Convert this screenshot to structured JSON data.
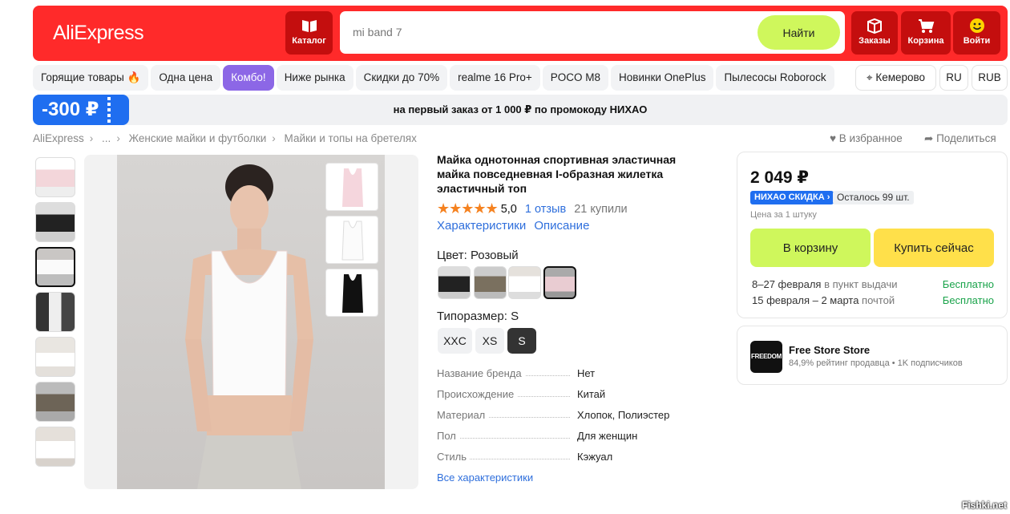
{
  "header": {
    "logo": "AliExpress",
    "catalog_label": "Каталог",
    "search_placeholder": "mi band 7",
    "search_button": "Найти",
    "orders_label": "Заказы",
    "cart_label": "Корзина",
    "login_label": "Войти",
    "brand_color": "#ff2a2a"
  },
  "chips": [
    "Горящие товары 🔥",
    "Одна цена",
    "Комбо!",
    "Ниже рынка",
    "Скидки до 70%",
    "realme 16 Pro+",
    "POCO M8",
    "Новинки OnePlus",
    "Пылесосы Roborock"
  ],
  "location": {
    "city": "Кемерово",
    "language": "RU",
    "currency": "RUB"
  },
  "promo": {
    "amount": "-300 ₽",
    "text": "на первый заказ от 1 000 ₽ по промокоду НИХАО"
  },
  "breadcrumbs": [
    "AliExpress",
    "...",
    "Женские майки и футболки",
    "Майки и топы на бретелях"
  ],
  "actions": {
    "favorite": "В избранное",
    "share": "Поделиться"
  },
  "product": {
    "title": "Майка однотонная спортивная эластичная майка повседневная I-образная жилетка эластичный топ",
    "rating": "5,0",
    "reviews": "1 отзыв",
    "bought": "21 купили",
    "tab_chars": "Характеристики",
    "tab_desc": "Описание",
    "color_label": "Цвет: Розовый",
    "size_label": "Типоразмер: S",
    "sizes": [
      "XXC",
      "XS",
      "S"
    ],
    "specs": [
      {
        "k": "Название бренда",
        "v": "Нет"
      },
      {
        "k": "Происхождение",
        "v": "Китай"
      },
      {
        "k": "Материал",
        "v": "Хлопок, Полиэстер"
      },
      {
        "k": "Пол",
        "v": "Для женщин"
      },
      {
        "k": "Стиль",
        "v": "Кэжуал"
      }
    ],
    "all_chars": "Все характеристики"
  },
  "buy": {
    "price": "2 049 ₽",
    "discount_badge": "НИХАО СКИДКА ›",
    "stock": "Осталось 99 шт.",
    "unit_price": "Цена за 1 штуку",
    "cart_button": "В корзину",
    "buy_now_button": "Купить сейчас",
    "delivery": [
      {
        "dates": "8–27 февраля",
        "where": " в пункт выдачи",
        "cost": "Бесплатно"
      },
      {
        "dates": "15 февраля – 2 марта",
        "where": " почтой",
        "cost": "Бесплатно"
      }
    ]
  },
  "seller": {
    "logo_text": "FREEDOM",
    "name": "Free Store Store",
    "meta": "84,9% рейтинг продавца  •  1K подписчиков"
  },
  "watermark": "Fishki.net"
}
